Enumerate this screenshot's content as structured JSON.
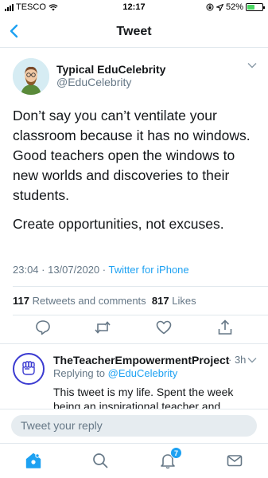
{
  "status_bar": {
    "carrier": "TESCO",
    "time": "12:17",
    "battery": "52%",
    "battery_level": 0.52
  },
  "nav": {
    "title": "Tweet"
  },
  "tweet": {
    "author_name": "Typical EduCelebrity",
    "author_handle": "@EduCelebrity",
    "paragraphs": [
      "Don’t say you can’t ventilate your classroom because it has no windows. Good teachers open the windows to new worlds and discoveries to their students.",
      "Create opportunities, not excuses."
    ],
    "timestamp": "23:04 · 13/07/2020 ·",
    "source": "Twitter for iPhone",
    "retweets_count": "117",
    "retweets_label": "Retweets and comments",
    "likes_count": "817",
    "likes_label": "Likes"
  },
  "reply": {
    "author_name": "TheTeacherEmpowermentProject",
    "time": "· 3h",
    "replying_prefix": "Replying to",
    "replying_mention": "@EduCelebrity",
    "text": "This tweet is my life. Spent the week being an inspirational teacher and"
  },
  "composer": {
    "placeholder": "Tweet your reply"
  },
  "tab_bar": {
    "notifications_badge": "7"
  },
  "colors": {
    "accent": "#1da1f2",
    "text": "#14171a",
    "secondary": "#657786"
  }
}
